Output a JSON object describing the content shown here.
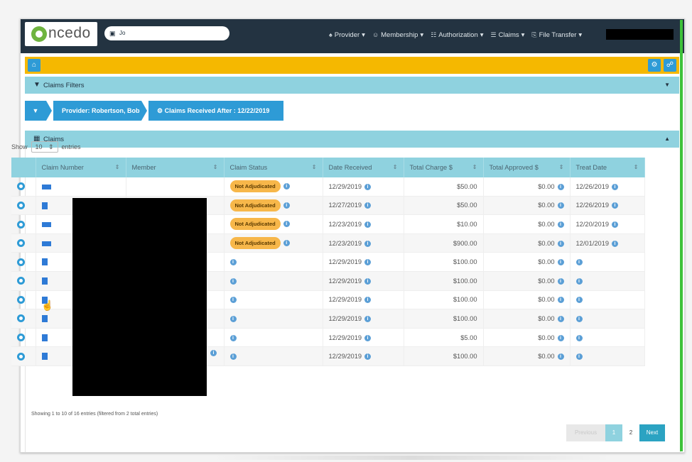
{
  "app": {
    "logo_text": "ncedo",
    "user_name": "Jo"
  },
  "nav": {
    "menu": [
      {
        "label": "Provider",
        "icon": "person-icon"
      },
      {
        "label": "Membership",
        "icon": "people-icon"
      },
      {
        "label": "Authorization",
        "icon": "sitemap-icon"
      },
      {
        "label": "Claims",
        "icon": "list-icon"
      },
      {
        "label": "File Transfer",
        "icon": "file-transfer-icon"
      }
    ]
  },
  "filters": {
    "title": "Claims Filters"
  },
  "breadcrumb": {
    "provider": "Provider: Robertson, Bob",
    "received": "Claims Received After : 12/22/2019"
  },
  "claims_panel": {
    "title": "Claims"
  },
  "length": {
    "show": "Show",
    "value": "10",
    "entries": "entries"
  },
  "table": {
    "headers": [
      "Claim Number",
      "Member",
      "Claim Status",
      "Date Received",
      "Total Charge $",
      "Total Approved $",
      "Treat Date"
    ],
    "rows": [
      {
        "status": "Not Adjudicated",
        "received": "12/29/2019",
        "charge": "$50.00",
        "approved": "$0.00",
        "treat": "12/26/2019"
      },
      {
        "status": "Not Adjudicated",
        "received": "12/27/2019",
        "charge": "$50.00",
        "approved": "$0.00",
        "treat": "12/26/2019"
      },
      {
        "status": "Not Adjudicated",
        "received": "12/23/2019",
        "charge": "$10.00",
        "approved": "$0.00",
        "treat": "12/20/2019"
      },
      {
        "status": "Not Adjudicated",
        "received": "12/23/2019",
        "charge": "$900.00",
        "approved": "$0.00",
        "treat": "12/01/2019"
      },
      {
        "status": "",
        "received": "12/29/2019",
        "charge": "$100.00",
        "approved": "$0.00",
        "treat": ""
      },
      {
        "status": "",
        "received": "12/29/2019",
        "charge": "$100.00",
        "approved": "$0.00",
        "treat": ""
      },
      {
        "status": "",
        "received": "12/29/2019",
        "charge": "$100.00",
        "approved": "$0.00",
        "treat": ""
      },
      {
        "status": "",
        "received": "12/29/2019",
        "charge": "$100.00",
        "approved": "$0.00",
        "treat": ""
      },
      {
        "status": "",
        "received": "12/29/2019",
        "charge": "$5.00",
        "approved": "$0.00",
        "treat": ""
      },
      {
        "status": "",
        "received": "12/29/2019",
        "charge": "$100.00",
        "approved": "$0.00",
        "treat": ""
      }
    ]
  },
  "footer": {
    "info": "Showing 1 to 10 of 16 entries (filtered from 2 total entries)"
  },
  "pager": {
    "prev": "Previous",
    "page1": "1",
    "page2": "2",
    "next": "Next"
  }
}
